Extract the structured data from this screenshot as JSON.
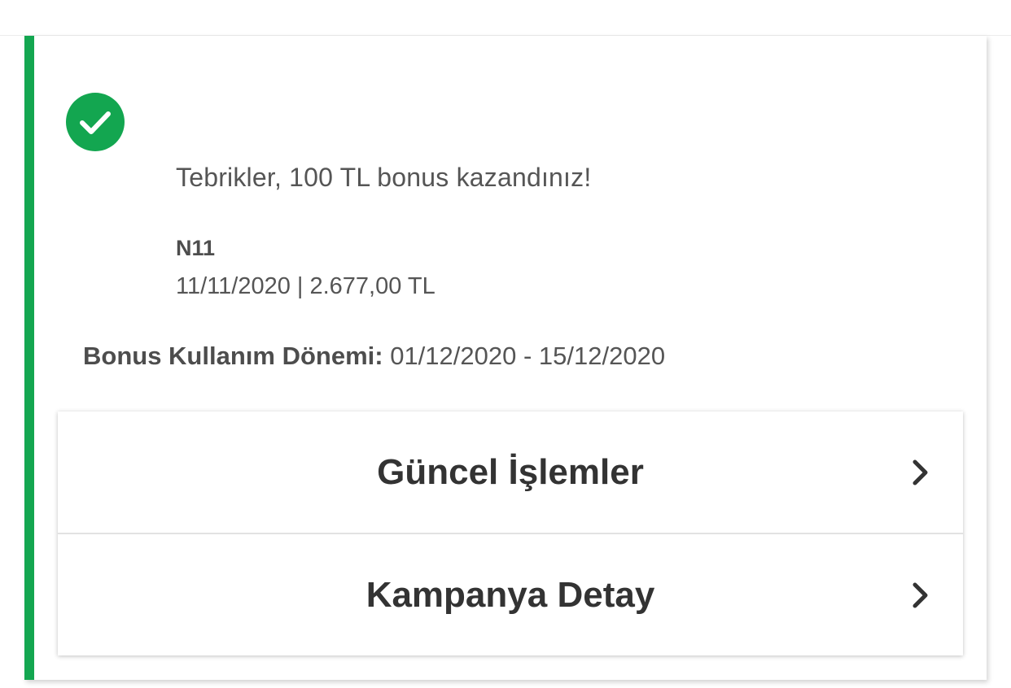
{
  "colors": {
    "accent": "#13a650",
    "text": "#555555",
    "heading": "#333333"
  },
  "status": {
    "icon": "check-circle-icon",
    "message": "Tebrikler, 100 TL bonus kazandınız!"
  },
  "transaction": {
    "merchant": "N11",
    "details": "11/11/2020 | 2.677,00 TL"
  },
  "bonus_period": {
    "label": "Bonus Kullanım Dönemi:",
    "value": "01/12/2020 - 15/12/2020"
  },
  "nav": {
    "items": [
      {
        "label": "Güncel İşlemler",
        "icon": "chevron-right-icon"
      },
      {
        "label": "Kampanya Detay",
        "icon": "chevron-right-icon"
      }
    ]
  }
}
